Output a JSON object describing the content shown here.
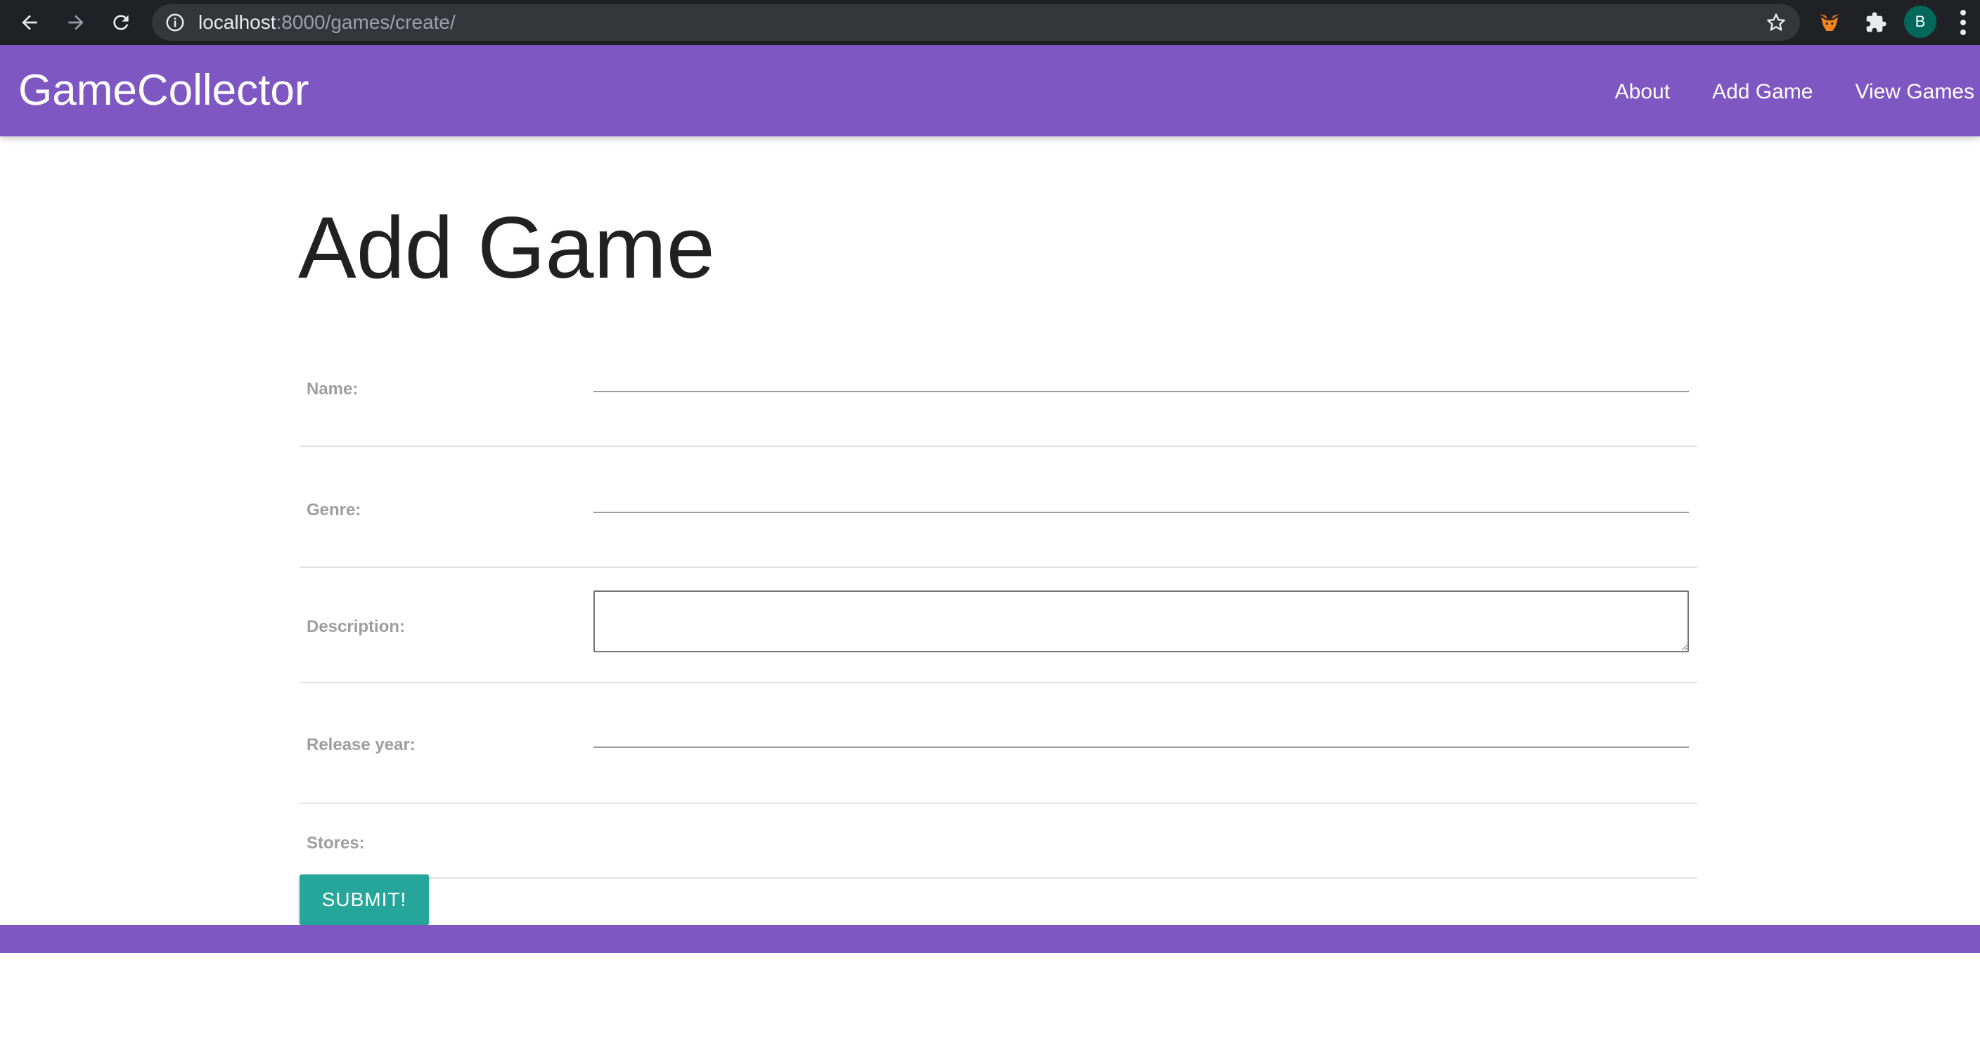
{
  "browser": {
    "url_host": "localhost",
    "url_rest": ":8000/games/create/",
    "avatar_letter": "B",
    "icons": {
      "back": "back-arrow-icon",
      "forward": "forward-arrow-icon",
      "reload": "reload-icon",
      "info": "info-icon",
      "bookmark": "star-icon",
      "metamask": "fox-icon",
      "extensions": "puzzle-icon",
      "menu": "kebab-menu-icon"
    }
  },
  "navbar": {
    "brand": "GameCollector",
    "links": [
      "About",
      "Add Game",
      "View Games"
    ],
    "color": "#7e57c2"
  },
  "page": {
    "title": "Add Game"
  },
  "form": {
    "fields": [
      {
        "label": "Name:",
        "value": ""
      },
      {
        "label": "Genre:",
        "value": ""
      },
      {
        "label": "Description:",
        "value": ""
      },
      {
        "label": "Release year:",
        "value": ""
      },
      {
        "label": "Stores:",
        "value": ""
      }
    ],
    "submit_label": "SUBMIT!",
    "submit_color": "#26a69a"
  }
}
